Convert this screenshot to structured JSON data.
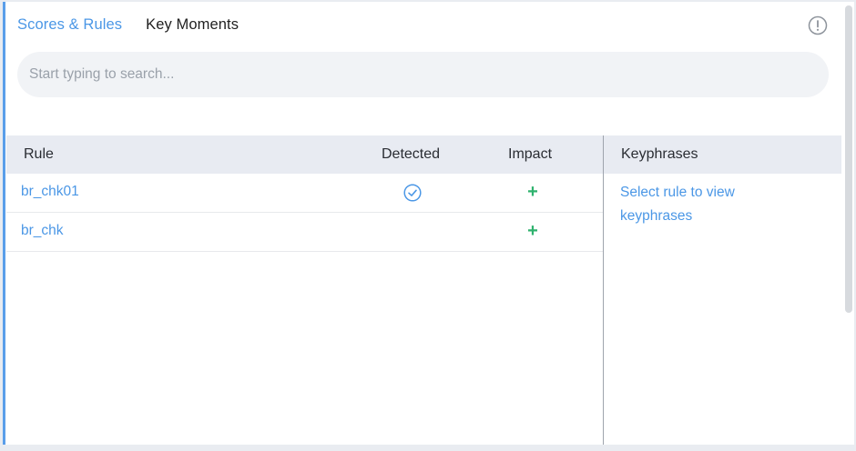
{
  "tabs": [
    {
      "label": "Scores & Rules",
      "active": true
    },
    {
      "label": "Key Moments",
      "active": false
    }
  ],
  "search": {
    "placeholder": "Start typing to search..."
  },
  "table": {
    "headers": {
      "rule": "Rule",
      "detected": "Detected",
      "impact": "Impact",
      "keyphrases": "Keyphrases"
    },
    "rows": [
      {
        "rule": "br_chk01",
        "detected": true,
        "impact": "+"
      },
      {
        "rule": "br_chk",
        "detected": false,
        "impact": "+"
      }
    ]
  },
  "keyphrases_hint": "Select rule to view keyphrases",
  "colors": {
    "accent": "#4b97e6",
    "impact_positive": "#2fb26e",
    "header_bg": "#e8ebf2",
    "left_border": "#5a9ee9"
  },
  "icons": {
    "info": "info-circle-icon",
    "detected": "check-circle-icon",
    "impact": "plus-icon"
  }
}
